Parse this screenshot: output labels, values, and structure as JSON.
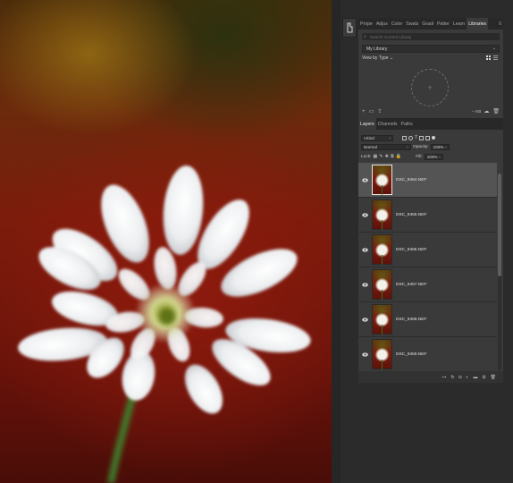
{
  "tools": {
    "icon": "healing-brush-icon"
  },
  "panel_tabs_top": [
    {
      "label": "Prope",
      "active": false
    },
    {
      "label": "Adjus",
      "active": false
    },
    {
      "label": "Color",
      "active": false
    },
    {
      "label": "Swats",
      "active": false
    },
    {
      "label": "Gradi",
      "active": false
    },
    {
      "label": "Patter",
      "active": false
    },
    {
      "label": "Learn",
      "active": false
    },
    {
      "label": "Libraries",
      "active": true
    }
  ],
  "libraries": {
    "search_placeholder": "Search Current Library",
    "library_name": "My Library",
    "view_by": "View by Type",
    "storage": "-- KB",
    "drop_icon": "+"
  },
  "layers_tabs": [
    {
      "label": "Layers",
      "active": true
    },
    {
      "label": "Channels",
      "active": false
    },
    {
      "label": "Paths",
      "active": false
    }
  ],
  "layers": {
    "filter_kind": "Kind",
    "blend_mode": "Normal",
    "opacity_label": "Opacity:",
    "opacity_value": "100%",
    "lock_label": "Lock:",
    "fill_label": "Fill:",
    "fill_value": "100%",
    "items": [
      {
        "name": "DSC_9454.NEF",
        "selected": true
      },
      {
        "name": "DSC_9455.NEF",
        "selected": false
      },
      {
        "name": "DSC_9456.NEF",
        "selected": false
      },
      {
        "name": "DSC_9457.NEF",
        "selected": false
      },
      {
        "name": "DSC_9458.NEF",
        "selected": false
      },
      {
        "name": "DSC_9459.NEF",
        "selected": false
      }
    ]
  },
  "colors": {
    "panel_bg": "#3a3a3a",
    "selected_row": "#545454",
    "app_bg": "#2b2b2b"
  }
}
